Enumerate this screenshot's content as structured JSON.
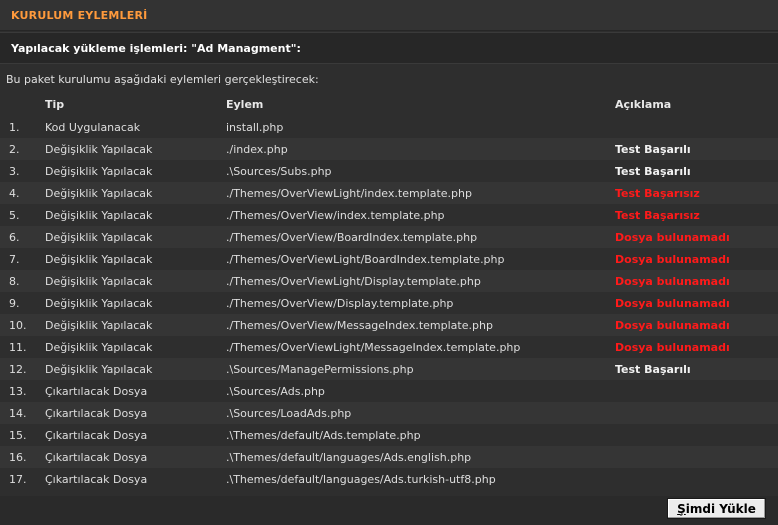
{
  "header": {
    "title": "KURULUM EYLEMLERİ",
    "title_color": "#ff9a3c"
  },
  "subheader": {
    "text": "Yapılacak yükleme işlemleri: \"Ad Managment\":"
  },
  "intro": "Bu paket kurulumu aşağıdaki eylemleri gerçekleştirecek:",
  "table": {
    "columns": {
      "num": "",
      "tip": "Tip",
      "eylem": "Eylem",
      "aciklama": "Açıklama"
    },
    "rows": [
      {
        "num": "1.",
        "tip": "Kod Uygulanacak",
        "eylem": "install.php",
        "aciklama": "",
        "status": ""
      },
      {
        "num": "2.",
        "tip": "Değişiklik Yapılacak",
        "eylem": "./index.php",
        "aciklama": "Test Başarılı",
        "status": "ok"
      },
      {
        "num": "3.",
        "tip": "Değişiklik Yapılacak",
        "eylem": ".\\Sources/Subs.php",
        "aciklama": "Test Başarılı",
        "status": "ok"
      },
      {
        "num": "4.",
        "tip": "Değişiklik Yapılacak",
        "eylem": "./Themes/OverViewLight/index.template.php",
        "aciklama": "Test Başarısız",
        "status": "bad"
      },
      {
        "num": "5.",
        "tip": "Değişiklik Yapılacak",
        "eylem": "./Themes/OverView/index.template.php",
        "aciklama": "Test Başarısız",
        "status": "bad"
      },
      {
        "num": "6.",
        "tip": "Değişiklik Yapılacak",
        "eylem": "./Themes/OverView/BoardIndex.template.php",
        "aciklama": "Dosya bulunamadı",
        "status": "bad"
      },
      {
        "num": "7.",
        "tip": "Değişiklik Yapılacak",
        "eylem": "./Themes/OverViewLight/BoardIndex.template.php",
        "aciklama": "Dosya bulunamadı",
        "status": "bad"
      },
      {
        "num": "8.",
        "tip": "Değişiklik Yapılacak",
        "eylem": "./Themes/OverViewLight/Display.template.php",
        "aciklama": "Dosya bulunamadı",
        "status": "bad"
      },
      {
        "num": "9.",
        "tip": "Değişiklik Yapılacak",
        "eylem": "./Themes/OverView/Display.template.php",
        "aciklama": "Dosya bulunamadı",
        "status": "bad"
      },
      {
        "num": "10.",
        "tip": "Değişiklik Yapılacak",
        "eylem": "./Themes/OverView/MessageIndex.template.php",
        "aciklama": "Dosya bulunamadı",
        "status": "bad"
      },
      {
        "num": "11.",
        "tip": "Değişiklik Yapılacak",
        "eylem": "./Themes/OverViewLight/MessageIndex.template.php",
        "aciklama": "Dosya bulunamadı",
        "status": "bad"
      },
      {
        "num": "12.",
        "tip": "Değişiklik Yapılacak",
        "eylem": ".\\Sources/ManagePermissions.php",
        "aciklama": "Test Başarılı",
        "status": "ok"
      },
      {
        "num": "13.",
        "tip": "Çıkartılacak Dosya",
        "eylem": ".\\Sources/Ads.php",
        "aciklama": "",
        "status": ""
      },
      {
        "num": "14.",
        "tip": "Çıkartılacak Dosya",
        "eylem": ".\\Sources/LoadAds.php",
        "aciklama": "",
        "status": ""
      },
      {
        "num": "15.",
        "tip": "Çıkartılacak Dosya",
        "eylem": ".\\Themes/default/Ads.template.php",
        "aciklama": "",
        "status": ""
      },
      {
        "num": "16.",
        "tip": "Çıkartılacak Dosya",
        "eylem": ".\\Themes/default/languages/Ads.english.php",
        "aciklama": "",
        "status": ""
      },
      {
        "num": "17.",
        "tip": "Çıkartılacak Dosya",
        "eylem": ".\\Themes/default/languages/Ads.turkish-utf8.php",
        "aciklama": "",
        "status": ""
      }
    ]
  },
  "button": {
    "label_underlined": "Ş",
    "label_rest": "imdi Yükle"
  }
}
